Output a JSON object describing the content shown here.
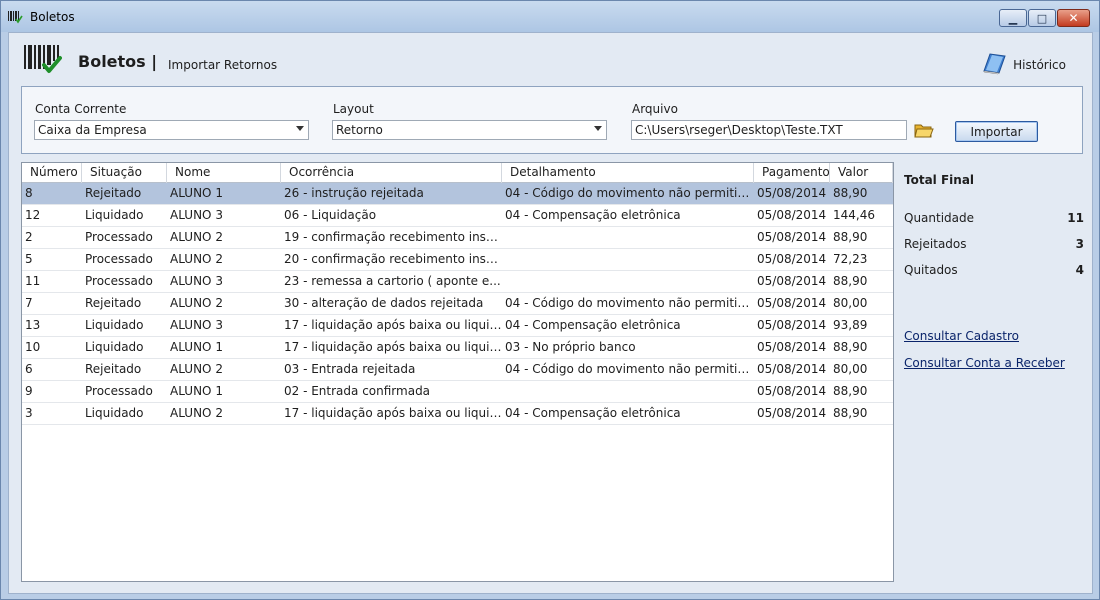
{
  "window": {
    "title": "Boletos",
    "controls": {
      "minimize": "▁",
      "maximize": "□",
      "close": "✕"
    }
  },
  "header": {
    "title": "Boletos |",
    "subtitle": "Importar Retornos",
    "history_label": "Histórico",
    "icons": {
      "logo": "barcode-check-icon",
      "history": "book-icon"
    }
  },
  "filters": {
    "conta_label": "Conta Corrente",
    "conta_value": "Caixa da Empresa",
    "layout_label": "Layout",
    "layout_value": "Retorno",
    "arquivo_label": "Arquivo",
    "arquivo_value": "C:\\Users\\rseger\\Desktop\\Teste.TXT",
    "importar_label": "Importar",
    "folder_icon": "folder-open-icon"
  },
  "grid": {
    "columns": [
      "Número",
      "Situação",
      "Nome",
      "Ocorrência",
      "Detalhamento",
      "Pagamento",
      "Valor"
    ],
    "selected_index": 0,
    "rows": [
      [
        "8",
        "Rejeitado",
        "ALUNO 1",
        "26 - instrução rejeitada",
        "04 - Código do movimento não permitid...",
        "05/08/2014",
        "88,90"
      ],
      [
        "12",
        "Liquidado",
        "ALUNO 3",
        "06 - Liquidação",
        "04 - Compensação eletrônica",
        "05/08/2014",
        "144,46"
      ],
      [
        "2",
        "Processado",
        "ALUNO 2",
        "19 - confirmação recebimento instr...",
        "",
        "05/08/2014",
        "88,90"
      ],
      [
        "5",
        "Processado",
        "ALUNO 2",
        "20 - confirmação recebimento instr...",
        "",
        "05/08/2014",
        "72,23"
      ],
      [
        "11",
        "Processado",
        "ALUNO 3",
        "23 - remessa a cartorio ( aponte e...",
        "",
        "05/08/2014",
        "88,90"
      ],
      [
        "7",
        "Rejeitado",
        "ALUNO 2",
        "30 - alteração de dados rejeitada",
        "04 - Código do movimento não permitid...",
        "05/08/2014",
        "80,00"
      ],
      [
        "13",
        "Liquidado",
        "ALUNO 3",
        "17 - liquidação após baixa ou liquid...",
        "04 - Compensação eletrônica",
        "05/08/2014",
        "93,89"
      ],
      [
        "10",
        "Liquidado",
        "ALUNO 1",
        "17 - liquidação após baixa ou liquid...",
        "03 - No próprio banco",
        "05/08/2014",
        "88,90"
      ],
      [
        "6",
        "Rejeitado",
        "ALUNO 2",
        "03 - Entrada rejeitada",
        "04 - Código do movimento não permitid...",
        "05/08/2014",
        "80,00"
      ],
      [
        "9",
        "Processado",
        "ALUNO 1",
        "02 - Entrada confirmada",
        "",
        "05/08/2014",
        "88,90"
      ],
      [
        "3",
        "Liquidado",
        "ALUNO 2",
        "17 - liquidação após baixa ou liquid...",
        "04 - Compensação eletrônica",
        "05/08/2014",
        "88,90"
      ]
    ]
  },
  "summary": {
    "title": "Total Final",
    "items": [
      {
        "label": "Quantidade",
        "value": "11"
      },
      {
        "label": "Rejeitados",
        "value": "3"
      },
      {
        "label": "Quitados",
        "value": "4"
      }
    ],
    "links": {
      "consultar_cadastro": "Consultar Cadastro",
      "consultar_conta": "Consultar Conta a Receber"
    }
  }
}
